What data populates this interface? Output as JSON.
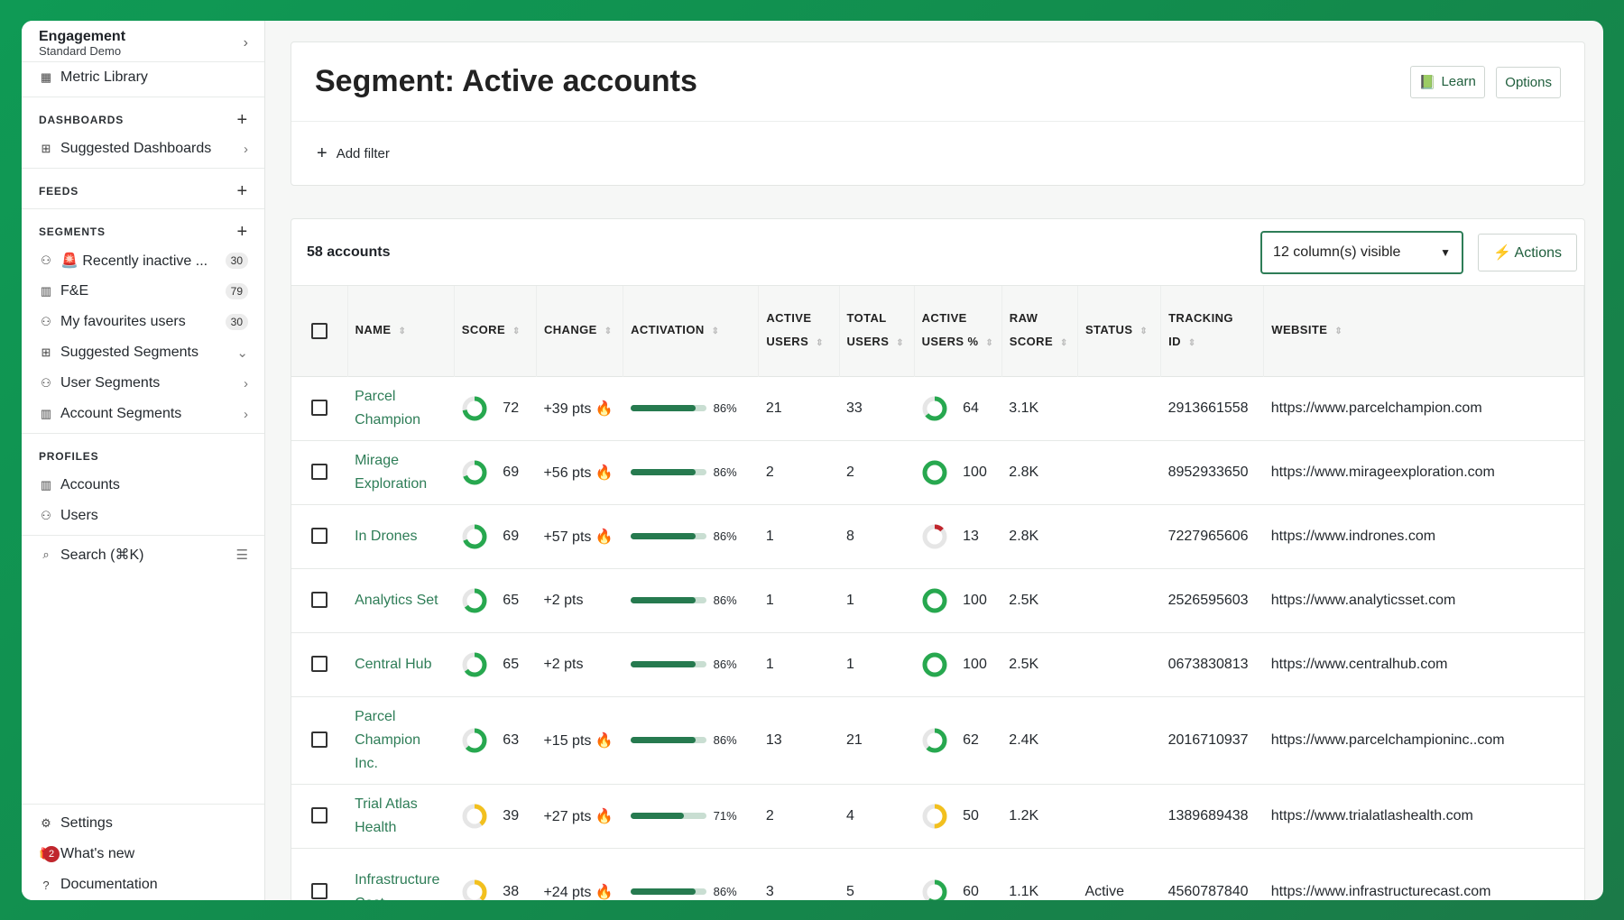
{
  "workspace": {
    "name": "Engagement",
    "sub": "Standard Demo"
  },
  "sidebar": {
    "metric_library": "Metric Library",
    "dashboards_title": "DASHBOARDS",
    "suggested_dashboards": "Suggested Dashboards",
    "feeds_title": "FEEDS",
    "segments_title": "SEGMENTS",
    "segments": [
      {
        "label": "🚨 Recently inactive ...",
        "count": "30",
        "icon": "users-icon"
      },
      {
        "label": "F&E",
        "count": "79",
        "icon": "building-icon"
      },
      {
        "label": "My favourites users",
        "count": "30",
        "icon": "users-icon"
      },
      {
        "label": "Suggested Segments",
        "count": "",
        "icon": "suggest-icon"
      },
      {
        "label": "User Segments",
        "count": "",
        "icon": "users-icon"
      },
      {
        "label": "Account Segments",
        "count": "",
        "icon": "building-icon"
      }
    ],
    "profiles_title": "PROFILES",
    "accounts": "Accounts",
    "users": "Users",
    "search": "Search (⌘K)",
    "settings": "Settings",
    "whats_new": "What's new",
    "whats_new_badge": "2",
    "documentation": "Documentation"
  },
  "header": {
    "title": "Segment: Active accounts",
    "learn": "Learn",
    "options": "Options",
    "add_filter": "Add filter"
  },
  "table": {
    "count": "58 accounts",
    "columns_visible": "12 column(s) visible",
    "actions": "⚡ Actions",
    "headers": {
      "name": "NAME",
      "score": "SCORE",
      "change": "CHANGE",
      "activation": "ACTIVATION",
      "active_users": "ACTIVE USERS",
      "total_users": "TOTAL USERS",
      "active_pct": "ACTIVE USERS %",
      "raw": "RAW SCORE",
      "status": "STATUS",
      "tracking": "TRACKING ID",
      "website": "WEBSITE"
    },
    "rows": [
      {
        "name": "Parcel Champion",
        "score": "72",
        "change": "+39 pts 🔥",
        "activation": "86%",
        "act_val": 0.86,
        "active": "21",
        "total": "33",
        "pct": "64",
        "raw": "3.1K",
        "status": "",
        "tracking": "2913661558",
        "website": "https://www.parcelchampion.com"
      },
      {
        "name": "Mirage Exploration",
        "score": "69",
        "change": "+56 pts 🔥",
        "activation": "86%",
        "act_val": 0.86,
        "active": "2",
        "total": "2",
        "pct": "100",
        "raw": "2.8K",
        "status": "",
        "tracking": "8952933650",
        "website": "https://www.mirageexploration.com"
      },
      {
        "name": "In Drones",
        "score": "69",
        "change": "+57 pts 🔥",
        "activation": "86%",
        "act_val": 0.86,
        "active": "1",
        "total": "8",
        "pct": "13",
        "raw": "2.8K",
        "status": "",
        "tracking": "7227965606",
        "website": "https://www.indrones.com"
      },
      {
        "name": "Analytics Set",
        "score": "65",
        "change": "+2 pts",
        "activation": "86%",
        "act_val": 0.86,
        "active": "1",
        "total": "1",
        "pct": "100",
        "raw": "2.5K",
        "status": "",
        "tracking": "2526595603",
        "website": "https://www.analyticsset.com"
      },
      {
        "name": "Central Hub",
        "score": "65",
        "change": "+2 pts",
        "activation": "86%",
        "act_val": 0.86,
        "active": "1",
        "total": "1",
        "pct": "100",
        "raw": "2.5K",
        "status": "",
        "tracking": "0673830813",
        "website": "https://www.centralhub.com"
      },
      {
        "name": "Parcel Champion Inc.",
        "score": "63",
        "change": "+15 pts 🔥",
        "activation": "86%",
        "act_val": 0.86,
        "active": "13",
        "total": "21",
        "pct": "62",
        "raw": "2.4K",
        "status": "",
        "tracking": "2016710937",
        "website": "https://www.parcelchampioninc..com"
      },
      {
        "name": "Trial Atlas Health",
        "score": "39",
        "change": "+27 pts 🔥",
        "activation": "71%",
        "act_val": 0.71,
        "active": "2",
        "total": "4",
        "pct": "50",
        "raw": "1.2K",
        "status": "",
        "tracking": "1389689438",
        "website": "https://www.trialatlashealth.com"
      },
      {
        "name": "Infrastructure Cast",
        "score": "38",
        "change": "+24 pts 🔥",
        "activation": "86%",
        "act_val": 0.86,
        "active": "3",
        "total": "5",
        "pct": "60",
        "raw": "1.1K",
        "status": "Active",
        "tracking": "4560787840",
        "website": "https://www.infrastructurecast.com"
      }
    ]
  },
  "colors": {
    "green": "#27a84f",
    "yellow": "#f2c01e",
    "red": "#c0262d",
    "track": "#e6e6e6"
  }
}
